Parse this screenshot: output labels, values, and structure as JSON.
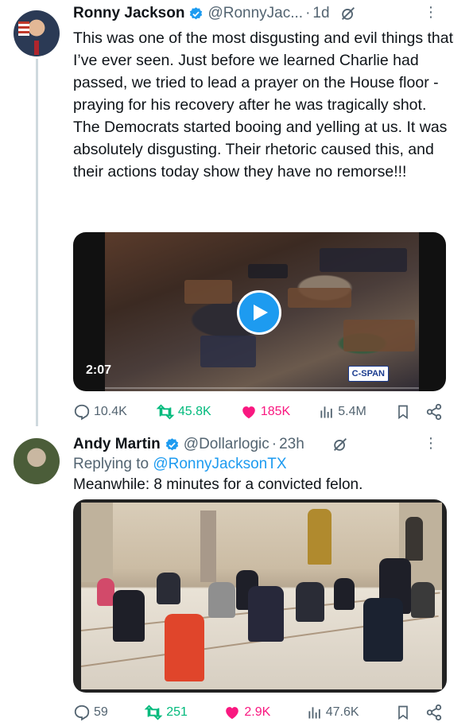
{
  "tweets": [
    {
      "author": "Ronny Jackson",
      "handle": "@RonnyJac...",
      "time": "1d",
      "text": "This was one of the most disgusting and evil things that I’ve ever seen. Just before we learned Charlie had passed, we tried to lead a prayer on the House floor - praying for his recovery after he was tragically shot. The Democrats started booing and yelling at us. It was absolutely disgusting. Their rhetoric caused this, and their actions today show they have no remorse!!!",
      "video": {
        "duration": "2:07",
        "watermark": "C-SPAN"
      },
      "stats": {
        "replies": "10.4K",
        "retweets": "45.8K",
        "likes": "185K",
        "views": "5.4M"
      }
    },
    {
      "author": "Andy Martin",
      "handle": "@Dollarlogic",
      "time": "23h",
      "reply_label": "Replying to",
      "reply_mention": "@RonnyJacksonTX",
      "text": "Meanwhile: 8 minutes for a convicted felon.",
      "stats": {
        "replies": "59",
        "retweets": "251",
        "likes": "2.9K",
        "views": "47.6K"
      }
    }
  ],
  "separator": "·",
  "colors": {
    "verified": "#1d9bf0",
    "retweet": "#00ba7c",
    "like": "#f91880",
    "muted": "#536471"
  },
  "icons": [
    "verified-icon",
    "grok-icon",
    "more-icon",
    "reply-icon",
    "retweet-icon",
    "heart-icon",
    "views-icon",
    "bookmark-icon",
    "share-icon",
    "play-icon"
  ]
}
